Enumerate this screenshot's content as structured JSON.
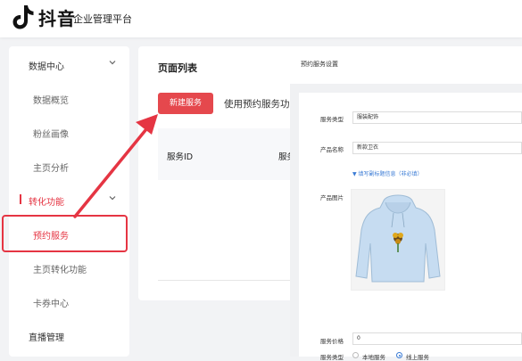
{
  "header": {
    "brand": "抖音",
    "brand_sub": "企业管理平台"
  },
  "sidebar": {
    "items": [
      {
        "label": "数据中心"
      },
      {
        "label": "数据概览"
      },
      {
        "label": "粉丝画像"
      },
      {
        "label": "主页分析"
      },
      {
        "label": "转化功能"
      },
      {
        "label": "预约服务"
      },
      {
        "label": "主页转化功能"
      },
      {
        "label": "卡券中心"
      },
      {
        "label": "直播管理"
      }
    ]
  },
  "main": {
    "title": "页面列表",
    "new_button": "新建服务",
    "tab_text": "使用预约服务功",
    "columns": [
      "服务ID",
      "服务"
    ]
  },
  "drawer": {
    "title": "预约服务设置",
    "service_type_label": "服务类型",
    "service_type_value": "服装配饰",
    "product_name_label": "产品名称",
    "product_name_value": "新款卫衣",
    "expand_link": "▼ 填写副标题信息（非必填）",
    "product_image_label": "产品图片",
    "service_mode_label": "服务类型",
    "service_mode_options": [
      "本地服务",
      "线上服务"
    ],
    "price_label": "服务价格",
    "price_value": "0"
  },
  "colors": {
    "accent": "#e53543",
    "button": "#e5484d",
    "link": "#3a7bd5"
  }
}
